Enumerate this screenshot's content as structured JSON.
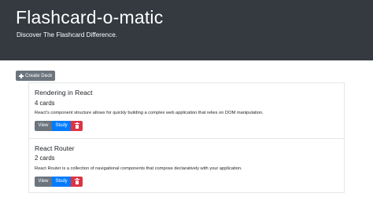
{
  "header": {
    "title": "Flashcard-o-matic",
    "subtitle": "Discover The Flashcard Difference."
  },
  "toolbar": {
    "create_icon": "plus-icon",
    "create_label": "Create Deck"
  },
  "decks": [
    {
      "name": "Rendering in React",
      "count": "4 cards",
      "description": "React's component structure allows for quickly building a complex web application that relies on DOM manipulation.",
      "view_label": "View",
      "study_label": "Study",
      "delete_icon": "trash-icon"
    },
    {
      "name": "React Router",
      "count": "2 cards",
      "description": "React Router is a collection of navigational components that compose declaratively with your application.",
      "view_label": "View",
      "study_label": "Study",
      "delete_icon": "trash-icon"
    }
  ],
  "colors": {
    "header_bg": "#343a40",
    "secondary": "#6c757d",
    "primary": "#007bff",
    "danger": "#dc3545"
  }
}
